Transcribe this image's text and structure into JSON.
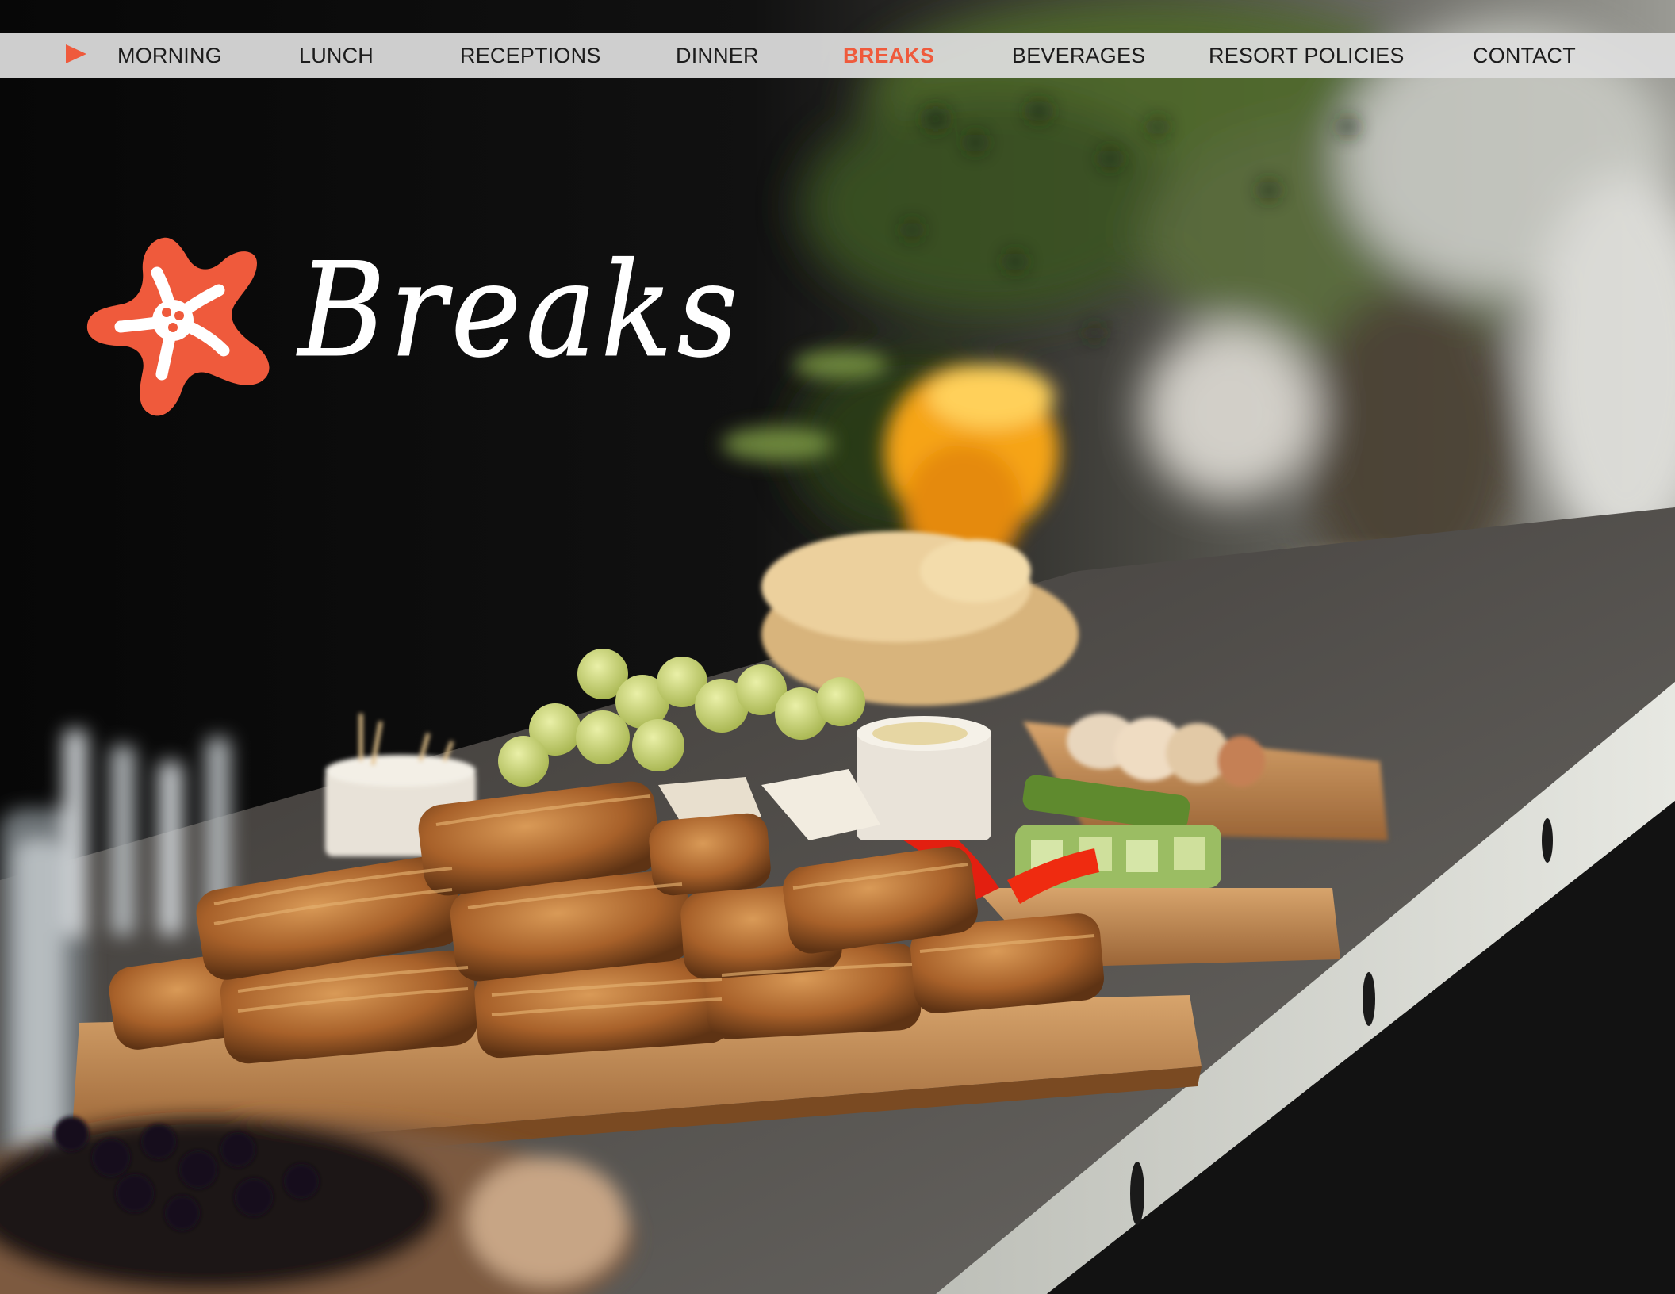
{
  "nav": {
    "items": [
      {
        "label": "MORNING",
        "active": false
      },
      {
        "label": "LUNCH",
        "active": false
      },
      {
        "label": "RECEPTIONS",
        "active": false
      },
      {
        "label": "DINNER",
        "active": false
      },
      {
        "label": "BREAKS",
        "active": true
      },
      {
        "label": "BEVERAGES",
        "active": false
      },
      {
        "label": "RESORT POLICIES",
        "active": false
      },
      {
        "label": "CONTACT",
        "active": false
      }
    ]
  },
  "hero": {
    "title": "Breaks",
    "logo_icon": "starfish-icon",
    "background": "buffet-photo"
  },
  "colors": {
    "accent": "#ef5a3c",
    "nav_bg": "#dedede",
    "nav_text": "#1c1c1c",
    "title_text": "#ffffff"
  }
}
